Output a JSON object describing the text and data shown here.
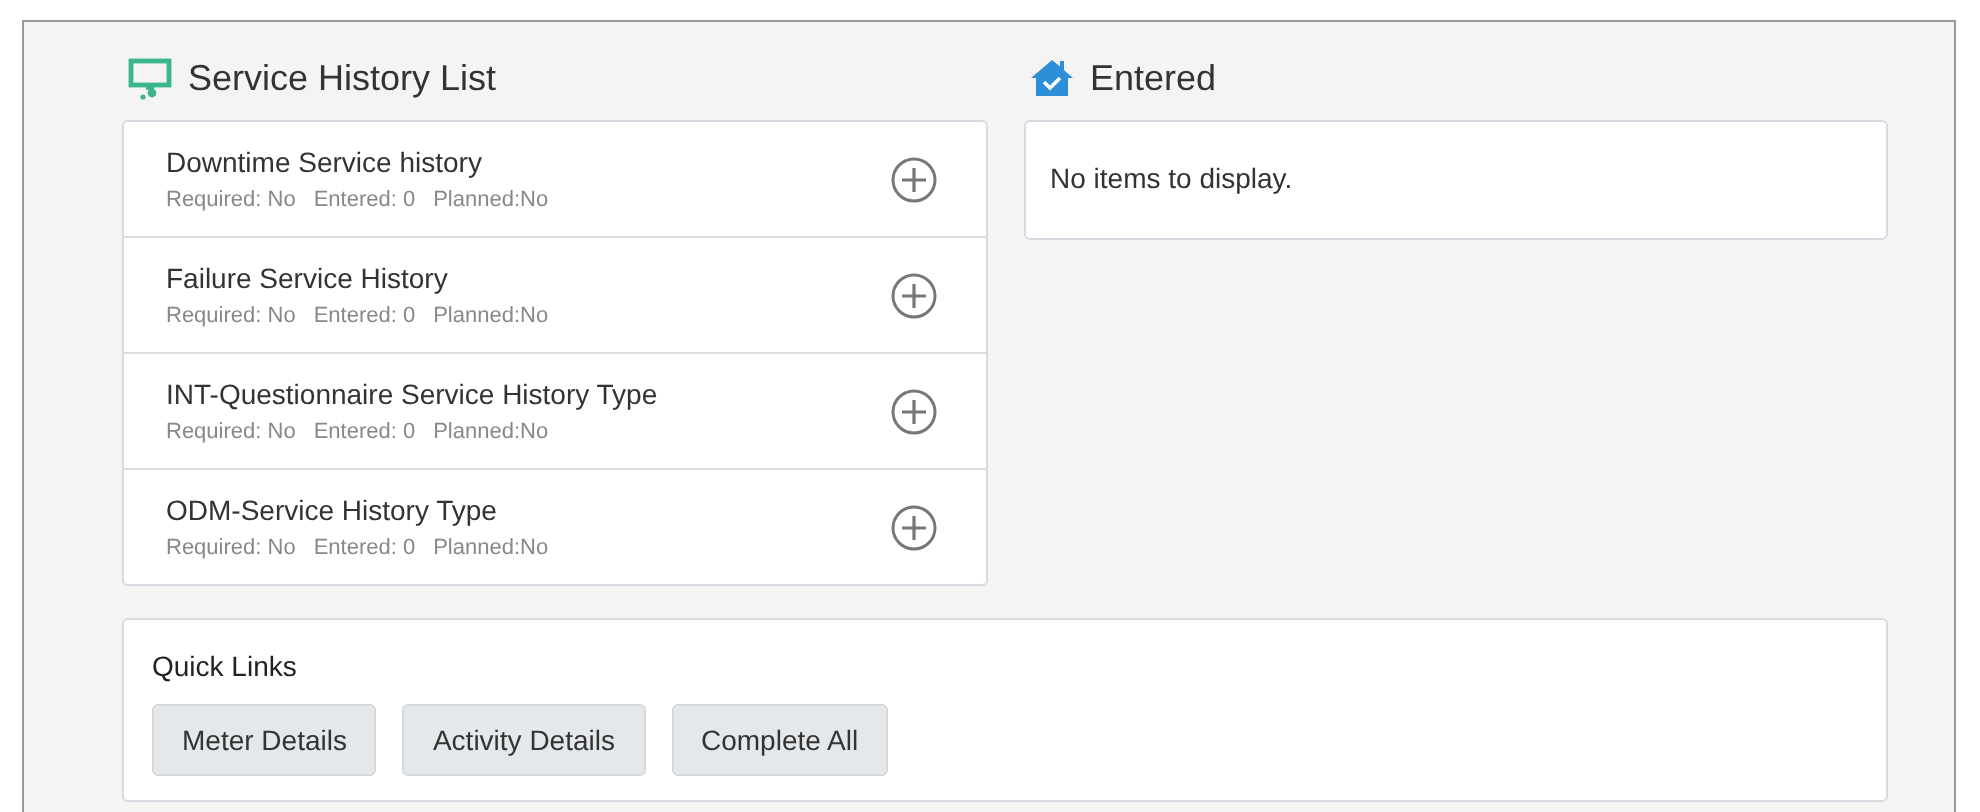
{
  "service_history": {
    "title": "Service History List",
    "items": [
      {
        "name": "Downtime Service history",
        "required": "Required: No",
        "entered": "Entered: 0",
        "planned": "Planned:No"
      },
      {
        "name": "Failure Service History",
        "required": "Required: No",
        "entered": "Entered: 0",
        "planned": "Planned:No"
      },
      {
        "name": "INT-Questionnaire Service History Type",
        "required": "Required: No",
        "entered": "Entered: 0",
        "planned": "Planned:No"
      },
      {
        "name": "ODM-Service History Type",
        "required": "Required: No",
        "entered": "Entered: 0",
        "planned": "Planned:No"
      }
    ]
  },
  "entered": {
    "title": "Entered",
    "empty_message": "No items to display."
  },
  "quick_links": {
    "title": "Quick Links",
    "buttons": [
      "Meter Details",
      "Activity Details",
      "Complete All"
    ]
  }
}
